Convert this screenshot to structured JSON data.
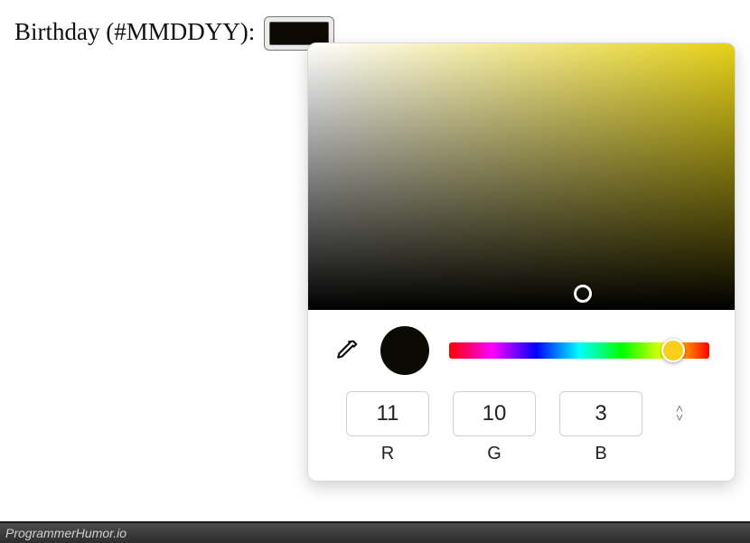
{
  "label": "Birthday (#MMDDYY):",
  "swatch_color": "#0b0a03",
  "picker": {
    "hue_color": "#e6d218",
    "current_color": "#0b0a03",
    "channels": {
      "r": {
        "value": "11",
        "label": "R"
      },
      "g": {
        "value": "10",
        "label": "G"
      },
      "b": {
        "value": "3",
        "label": "B"
      }
    }
  },
  "footer": "ProgrammerHumor.io"
}
